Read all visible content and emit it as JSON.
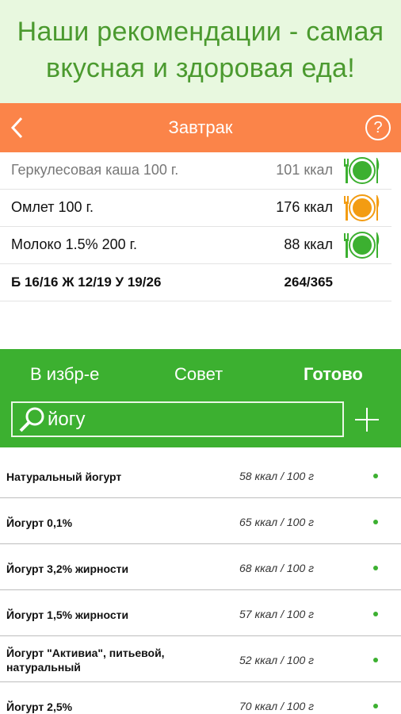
{
  "promo": {
    "line1": "Наши рекомендации - самая",
    "line2": "вкусная и здоровая еда!"
  },
  "topbar": {
    "title": "Завтрак",
    "help": "?"
  },
  "meal": {
    "items": [
      {
        "name": "Геркулесовая каша 100 г.",
        "kcal": "101 ккал",
        "plate_color": "#3cb030"
      },
      {
        "name": "Омлет 100 г.",
        "kcal": "176 ккал",
        "plate_color": "#f39c12"
      },
      {
        "name": "Молоко 1.5% 200 г.",
        "kcal": "88 ккал",
        "plate_color": "#3cb030"
      }
    ],
    "totals": {
      "macros": "Б 16/16 Ж 12/19 У 19/26",
      "kcal": "264/365"
    }
  },
  "tabs": {
    "favorites": "В избр-е",
    "advice": "Совет",
    "done": "Готово"
  },
  "search": {
    "query": "йогу"
  },
  "results": [
    {
      "name": "Натуральный йогурт",
      "kcal": "58 ккал / 100 г"
    },
    {
      "name": "Йогурт 0,1%",
      "kcal": "65 ккал / 100 г"
    },
    {
      "name": "Йогурт 3,2% жирности",
      "kcal": "68 ккал / 100 г"
    },
    {
      "name": "Йогурт 1,5% жирности",
      "kcal": "57 ккал / 100 г"
    },
    {
      "name": "Йогурт \"Активиа\", питьевой, натуральный",
      "kcal": "52 ккал / 100 г"
    },
    {
      "name": "Йогурт 2,5%",
      "kcal": "70 ккал / 100 г"
    }
  ]
}
